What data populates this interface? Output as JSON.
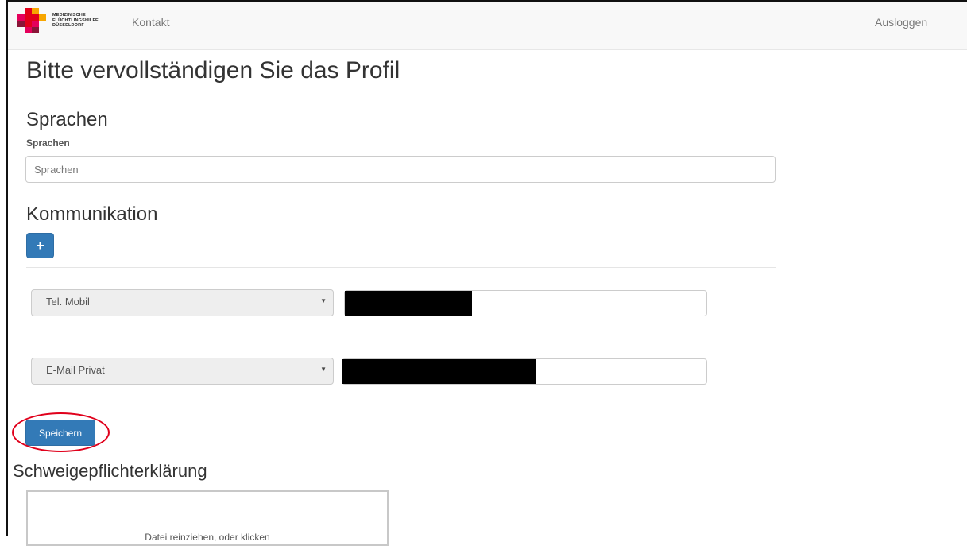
{
  "navbar": {
    "brand": {
      "line1": "MEDIZINISCHE",
      "line2": "FLÜCHTLINGSHILFE",
      "line3": "DÜSSELDORF",
      "colors": [
        "#e2001a",
        "#f7a600",
        "#e5005b",
        "#8a1538"
      ]
    },
    "links": {
      "kontakt": "Kontakt",
      "logout": "Ausloggen"
    }
  },
  "page": {
    "title": "Bitte vervollständigen Sie das Profil"
  },
  "languages": {
    "heading": "Sprachen",
    "label": "Sprachen",
    "placeholder": "Sprachen"
  },
  "communication": {
    "heading": "Kommunikation",
    "add_button_icon": "plus-icon",
    "add_button_symbol": "+",
    "entries": [
      {
        "type": "Tel. Mobil"
      },
      {
        "type": "E-Mail Privat"
      }
    ]
  },
  "actions": {
    "save_label": "Speichern"
  },
  "confidentiality": {
    "heading": "Schweigepflichterklärung",
    "dropzone_text": "Datei reinziehen, oder klicken"
  },
  "colors": {
    "primary": "#337ab7",
    "highlight": "#e0001b",
    "redaction": "#000000"
  }
}
